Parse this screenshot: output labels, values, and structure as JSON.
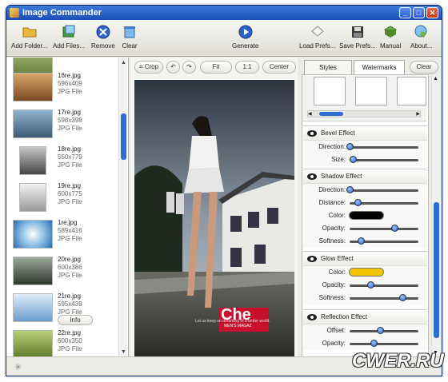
{
  "window": {
    "title": "Image Commander"
  },
  "toolbar": {
    "add_folder": "Add Folder...",
    "add_files": "Add Files...",
    "remove": "Remove",
    "clear": "Clear",
    "generate": "Generate",
    "load_prefs": "Load Prefs...",
    "save_prefs": "Save Prefs...",
    "manual": "Manual",
    "about": "About..."
  },
  "files": [
    {
      "name": "16re.jpg",
      "dims": "596x409",
      "type": "JPG File"
    },
    {
      "name": "17re.jpg",
      "dims": "598x398",
      "type": "JPG File"
    },
    {
      "name": "18re.jpg",
      "dims": "550x779",
      "type": "JPG File"
    },
    {
      "name": "19re.jpg",
      "dims": "600x775",
      "type": "JPG File"
    },
    {
      "name": "1re.jpg",
      "dims": "589x416",
      "type": "JPG File"
    },
    {
      "name": "20re.jpg",
      "dims": "600x386",
      "type": "JPG File"
    },
    {
      "name": "21re.jpg",
      "dims": "595x439",
      "type": "JPG File"
    },
    {
      "name": "22re.jpg",
      "dims": "600x350",
      "type": "JPG File"
    }
  ],
  "info_button": "Info",
  "viewer": {
    "crop": "Crop",
    "fit": "Fit",
    "one_to_one": "1:1",
    "center": "Center",
    "magazine_logo": "Che",
    "magazine_sub": "MEN'S MAGAZ",
    "caption": "Let us keep on dreaming of a better world."
  },
  "tabs": {
    "styles": "Styles",
    "watermarks": "Watermarks",
    "clear": "Clear"
  },
  "bevel": {
    "title": "Bevel Effect",
    "direction": "Direction:",
    "size": "Size:",
    "direction_value": 0.0,
    "size_value": 0.05
  },
  "shadow": {
    "title": "Shadow Effect",
    "direction": "Direction:",
    "distance": "Distance:",
    "color": "Color:",
    "opacity": "Opacity:",
    "softness": "Softness:",
    "direction_value": 0.0,
    "distance_value": 0.12,
    "color_value": "#000000",
    "opacity_value": 0.7,
    "softness_value": 0.18
  },
  "glow": {
    "title": "Glow Effect",
    "color": "Color:",
    "opacity": "Opacity:",
    "softness": "Softness:",
    "color_value": "#f5c400",
    "opacity_value": 0.32,
    "softness_value": 0.82
  },
  "reflection": {
    "title": "Reflection Effect",
    "offset": "Offset:",
    "opacity": "Opacity:",
    "offset_value": 0.48,
    "opacity_value": 0.38
  },
  "watermark": {
    "watermark": "CWER.RU"
  }
}
